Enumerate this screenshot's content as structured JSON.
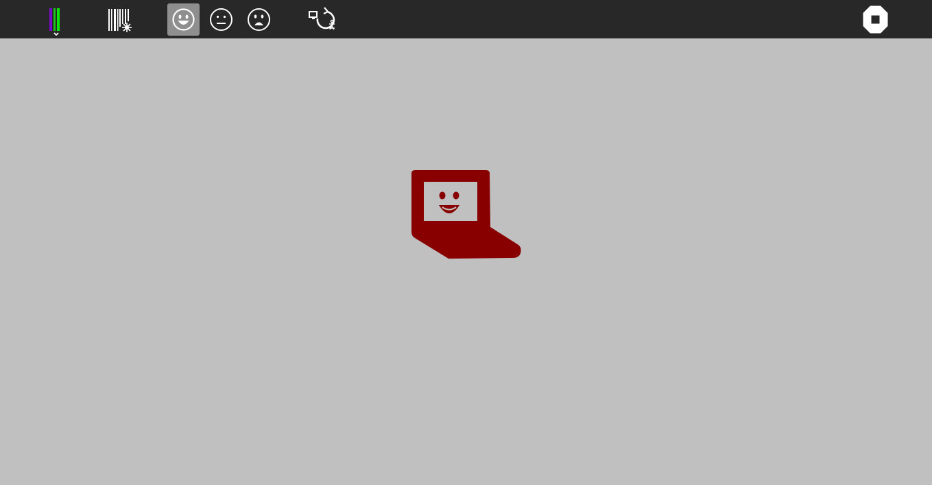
{
  "toolbar": {
    "palette": {
      "icon": "color-palette-icon",
      "colors": [
        "#7a0acb",
        "#19c419",
        "#09e809"
      ]
    },
    "barcode": {
      "icon": "barcode-laser-icon"
    },
    "mood_buttons": [
      {
        "icon": "happy-face-icon",
        "selected": true
      },
      {
        "icon": "neutral-face-icon",
        "selected": false
      },
      {
        "icon": "sad-face-icon",
        "selected": false
      }
    ],
    "share": {
      "icon": "network-share-icon"
    },
    "stop": {
      "icon": "stop-icon"
    }
  },
  "canvas": {
    "background": "#c0c0c0",
    "character": {
      "icon": "happy-laptop-icon",
      "color": "#880000",
      "mood": "happy"
    }
  },
  "colors": {
    "toolbar_bg": "#282828",
    "selected_bg": "#8f8f8f",
    "icon_fg": "#ffffff"
  }
}
